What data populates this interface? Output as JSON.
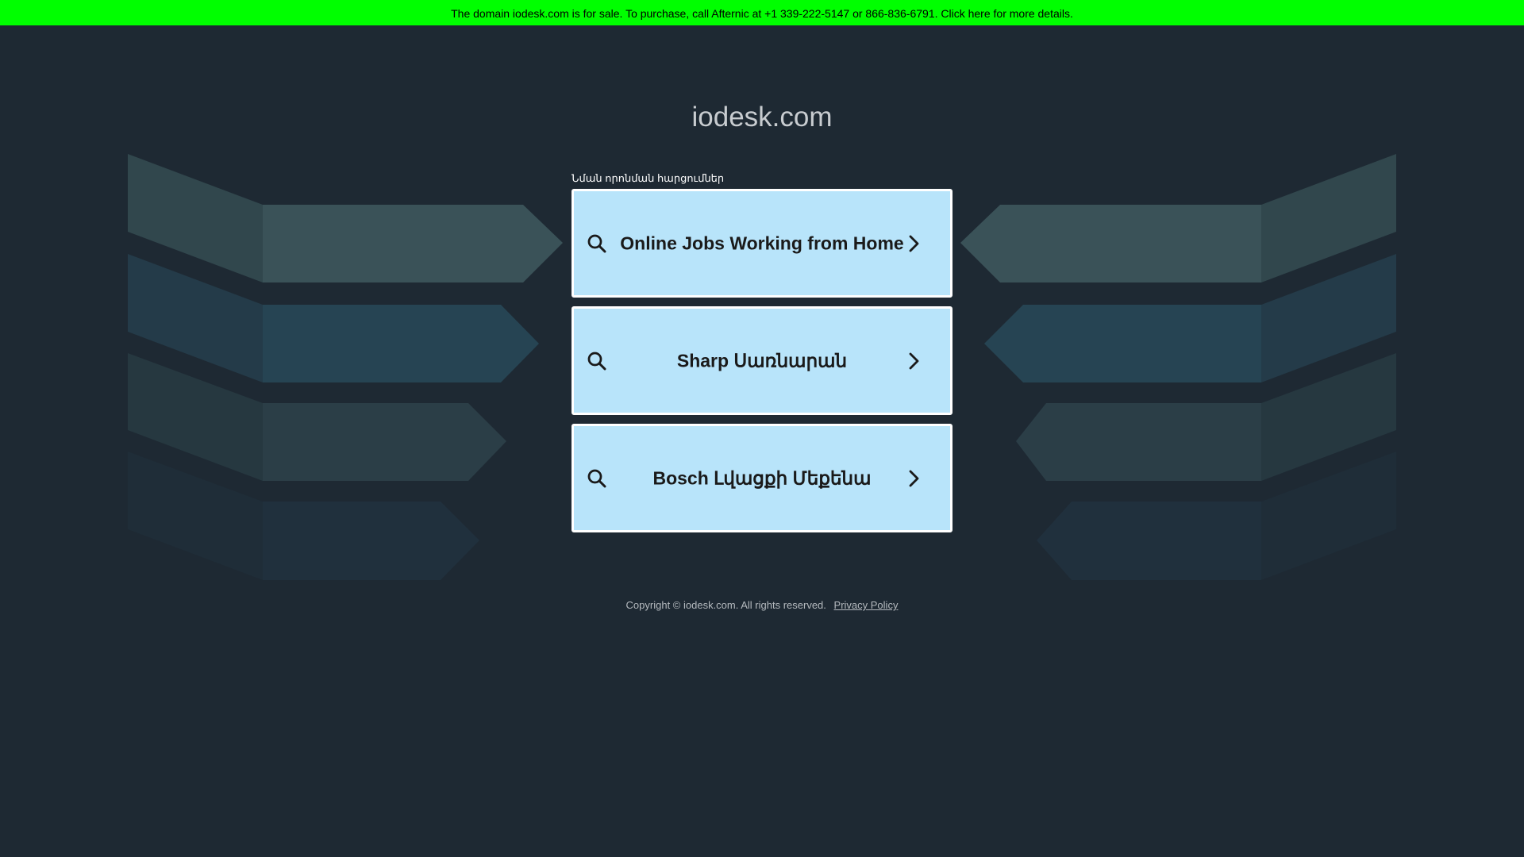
{
  "banner": {
    "text": "The domain iodesk.com is for sale. To purchase, call Afternic at +1 339-222-5147 or 866-836-6791. Click here for more details.",
    "color": "#00ff00"
  },
  "site_title": "iodesk.com",
  "related": {
    "label": "Նման որոնման հարցումներ",
    "items": [
      {
        "label": "Online Jobs Working from Home",
        "icon": "search-icon",
        "trailing_icon": "chevron-right-icon"
      },
      {
        "label": "Sharp Սառնարան",
        "icon": "search-icon",
        "trailing_icon": "chevron-right-icon"
      },
      {
        "label": "Bosch Լվացքի Մեքենա",
        "icon": "search-icon",
        "trailing_icon": "chevron-right-icon"
      }
    ]
  },
  "footer": {
    "copyright": "Copyright © iodesk.com.  All rights reserved.",
    "privacy_link": "Privacy Policy"
  },
  "colors": {
    "background": "#1e2933",
    "card": "#b8e4fa",
    "deco_row1_a": "#31474d",
    "deco_row1_b": "#3a5258",
    "deco_row2_a": "#243b49",
    "deco_row2_b": "#264453",
    "deco_row3_a": "#263840",
    "deco_row3_b": "#2b3e47",
    "deco_row4_a": "#1f2d38",
    "deco_row4_b": "#20303d"
  }
}
